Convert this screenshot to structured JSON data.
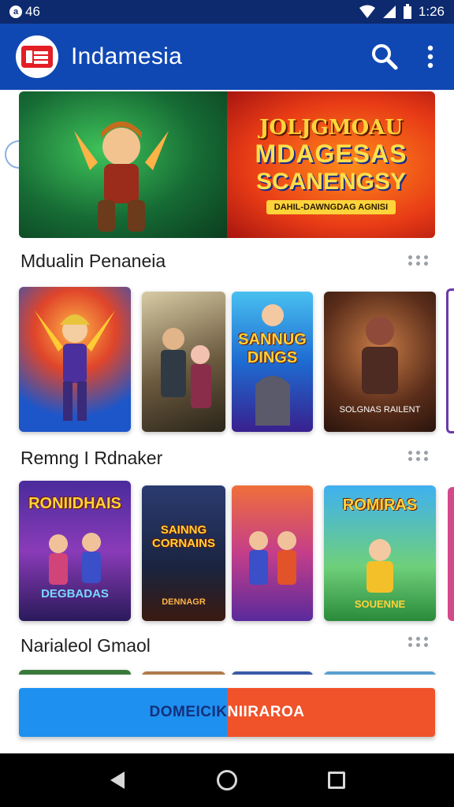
{
  "status_bar": {
    "left_text": "46",
    "time": "1:26"
  },
  "app_bar": {
    "title": "Indamesia",
    "actions": [
      "search-icon",
      "more-vert-icon"
    ]
  },
  "banner": {
    "tag": "",
    "title_line1": "JOLJGMOAU",
    "title_line2": "MDAGESAS",
    "title_line3": "SCANENGSY",
    "subtitle": "DAHIL-DAWNGDAG AGNISI"
  },
  "sections": [
    {
      "title": "Mdualin Penaneia",
      "cards": [
        {
          "title": "",
          "caption": ""
        },
        {
          "title": "",
          "caption": ""
        },
        {
          "title": "SANNUG DINGS",
          "caption": ""
        },
        {
          "title": "",
          "caption": "SOLGNAS RAILENT"
        }
      ]
    },
    {
      "title": "Remng I Rdnaker",
      "cards": [
        {
          "title": "RONIIDHAIS",
          "caption": "DEGBADAS"
        },
        {
          "title": "SAINNG CORNAINS",
          "caption": "DENNAGR"
        },
        {
          "title": "",
          "caption": ""
        },
        {
          "title": "ROMIRAS",
          "caption": "SOUENNE"
        }
      ]
    },
    {
      "title": "Narialeol Gmaol",
      "cards": []
    }
  ],
  "cta": {
    "label_left": "DOMEICIK",
    "label_right": "NIIRAROA"
  },
  "colors": {
    "status_bar": "#0d2a6e",
    "app_bar": "#1048b3",
    "cta_left": "#1e90f0",
    "cta_right": "#f0522a",
    "nav_bar": "#000000"
  },
  "nav": [
    "back-icon",
    "home-icon",
    "recents-icon"
  ]
}
